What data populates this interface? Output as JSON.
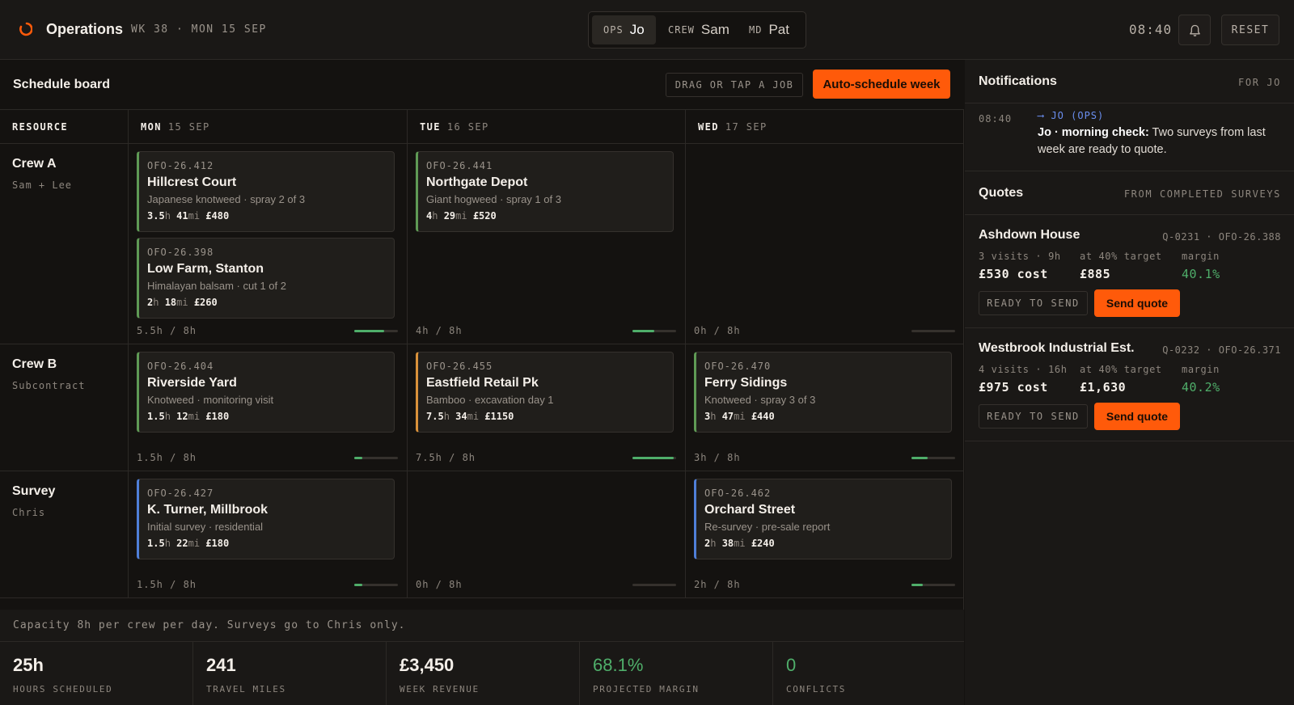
{
  "app": {
    "title": "Operations",
    "week": "WK 38 · MON 15 SEP",
    "clock": "08:40",
    "reset_label": "RESET"
  },
  "roles": [
    {
      "tag": "OPS",
      "name": "Jo",
      "active": true
    },
    {
      "tag": "CREW",
      "name": "Sam",
      "active": false
    },
    {
      "tag": "MD",
      "name": "Pat",
      "active": false
    }
  ],
  "board": {
    "title": "Schedule board",
    "drag_hint": "DRAG OR TAP A JOB",
    "auto_label": "Auto-schedule week",
    "resource_header": "RESOURCE",
    "days": [
      {
        "dow": "MON",
        "date": "15 SEP"
      },
      {
        "dow": "TUE",
        "date": "16 SEP"
      },
      {
        "dow": "WED",
        "date": "17 SEP"
      }
    ],
    "rows": [
      {
        "name": "Crew A",
        "sub": "Sam + Lee",
        "cells": [
          {
            "capacity": "5.5h / 8h",
            "fill": 0.69,
            "jobs": [
              {
                "id": "OFO-26.412",
                "name": "Hillcrest Court",
                "desc": "Japanese knotweed · spray 2 of 3",
                "hours": "3.5",
                "miles": "41",
                "price": "£480",
                "accent": "green"
              },
              {
                "id": "OFO-26.398",
                "name": "Low Farm, Stanton",
                "desc": "Himalayan balsam · cut 1 of 2",
                "hours": "2",
                "miles": "18",
                "price": "£260",
                "accent": "green"
              }
            ]
          },
          {
            "capacity": "4h / 8h",
            "fill": 0.5,
            "jobs": [
              {
                "id": "OFO-26.441",
                "name": "Northgate Depot",
                "desc": "Giant hogweed · spray 1 of 3",
                "hours": "4",
                "miles": "29",
                "price": "£520",
                "accent": "green"
              }
            ]
          },
          {
            "capacity": "0h / 8h",
            "fill": 0,
            "jobs": []
          }
        ]
      },
      {
        "name": "Crew B",
        "sub": "Subcontract",
        "cells": [
          {
            "capacity": "1.5h / 8h",
            "fill": 0.19,
            "jobs": [
              {
                "id": "OFO-26.404",
                "name": "Riverside Yard",
                "desc": "Knotweed · monitoring visit",
                "hours": "1.5",
                "miles": "12",
                "price": "£180",
                "accent": "green"
              }
            ]
          },
          {
            "capacity": "7.5h / 8h",
            "fill": 0.94,
            "jobs": [
              {
                "id": "OFO-26.455",
                "name": "Eastfield Retail Pk",
                "desc": "Bamboo · excavation day 1",
                "hours": "7.5",
                "miles": "34",
                "price": "£1150",
                "accent": "amber"
              }
            ]
          },
          {
            "capacity": "3h / 8h",
            "fill": 0.375,
            "jobs": [
              {
                "id": "OFO-26.470",
                "name": "Ferry Sidings",
                "desc": "Knotweed · spray 3 of 3",
                "hours": "3",
                "miles": "47",
                "price": "£440",
                "accent": "green"
              }
            ]
          }
        ]
      },
      {
        "name": "Survey",
        "sub": "Chris",
        "cells": [
          {
            "capacity": "1.5h / 8h",
            "fill": 0.19,
            "jobs": [
              {
                "id": "OFO-26.427",
                "name": "K. Turner, Millbrook",
                "desc": "Initial survey · residential",
                "hours": "1.5",
                "miles": "22",
                "price": "£180",
                "accent": "blue"
              }
            ]
          },
          {
            "capacity": "0h / 8h",
            "fill": 0,
            "jobs": []
          },
          {
            "capacity": "2h / 8h",
            "fill": 0.25,
            "jobs": [
              {
                "id": "OFO-26.462",
                "name": "Orchard Street",
                "desc": "Re-survey · pre-sale report",
                "hours": "2",
                "miles": "38",
                "price": "£240",
                "accent": "blue"
              }
            ]
          }
        ]
      }
    ],
    "footnote": "Capacity 8h per crew per day. Surveys go to Chris only."
  },
  "stats": [
    {
      "value": "25h",
      "label": "HOURS SCHEDULED",
      "green": false
    },
    {
      "value": "241",
      "label": "TRAVEL MILES",
      "green": false
    },
    {
      "value": "£3,450",
      "label": "WEEK REVENUE",
      "green": false
    },
    {
      "value": "68.1%",
      "label": "PROJECTED MARGIN",
      "green": true
    },
    {
      "value": "0",
      "label": "CONFLICTS",
      "green": true
    }
  ],
  "notifications": {
    "title": "Notifications",
    "meta": "FOR JO",
    "items": [
      {
        "time": "08:40",
        "to": "⟶ JO (OPS)",
        "bold": "Jo · morning check:",
        "text": " Two surveys from last week are ready to quote."
      }
    ]
  },
  "quotes": {
    "title": "Quotes",
    "meta": "FROM COMPLETED SURVEYS",
    "items": [
      {
        "name": "Ashdown House",
        "ref": "Q-0231 · OFO-26.388",
        "visits": "3 visits · 9h",
        "cost": "£530 cost",
        "target_label": "at 40% target",
        "target": "£885",
        "margin_label": "margin",
        "margin": "40.1%",
        "status": "READY TO SEND",
        "action": "Send quote"
      },
      {
        "name": "Westbrook Industrial Est.",
        "ref": "Q-0232 · OFO-26.371",
        "visits": "4 visits · 16h",
        "cost": "£975 cost",
        "target_label": "at 40% target",
        "target": "£1,630",
        "margin_label": "margin",
        "margin": "40.2%",
        "status": "READY TO SEND",
        "action": "Send quote"
      }
    ]
  },
  "colors": {
    "accent": "#ff5a0a",
    "green": "#4fae6a",
    "amber": "#d9913a",
    "blue": "#4f7fd8"
  }
}
